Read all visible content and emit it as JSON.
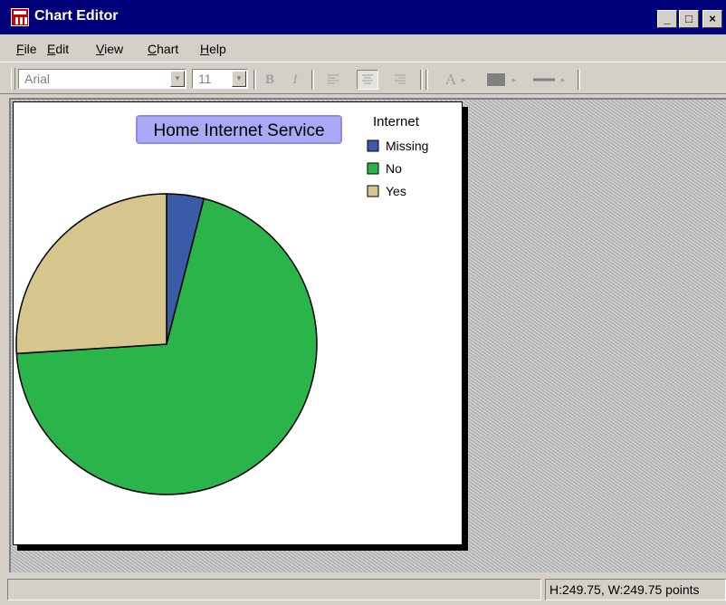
{
  "window": {
    "title": "Chart Editor",
    "buttons": {
      "minimize": "_",
      "maximize": "□",
      "close": "×"
    }
  },
  "menu": [
    {
      "label": "File",
      "mnemonic": "F",
      "rest": "ile"
    },
    {
      "label": "Edit",
      "mnemonic": "E",
      "rest": "dit"
    },
    {
      "label": "View",
      "mnemonic": "V",
      "rest": "iew"
    },
    {
      "label": "Chart",
      "mnemonic": "C",
      "rest": "hart"
    },
    {
      "label": "Help",
      "mnemonic": "H",
      "rest": "elp"
    }
  ],
  "toolbar": {
    "font_family": "Arial",
    "font_size": "11",
    "bold": "B",
    "italic": "I",
    "text_color": "A",
    "icons": [
      "align-left-icon",
      "align-center-icon",
      "align-right-icon",
      "fill-color-icon",
      "line-style-icon"
    ]
  },
  "chart_data": {
    "type": "pie",
    "title": "Home Internet Service",
    "legend_title": "Internet",
    "legend_position": "top-right",
    "categories": [
      "Missing",
      "No",
      "Yes"
    ],
    "values": [
      4,
      70,
      26
    ],
    "colors": [
      "#3a5ba8",
      "#2bb44a",
      "#d6c68e"
    ]
  },
  "status": {
    "left": "",
    "dimensions": "H:249.75, W:249.75 points"
  }
}
